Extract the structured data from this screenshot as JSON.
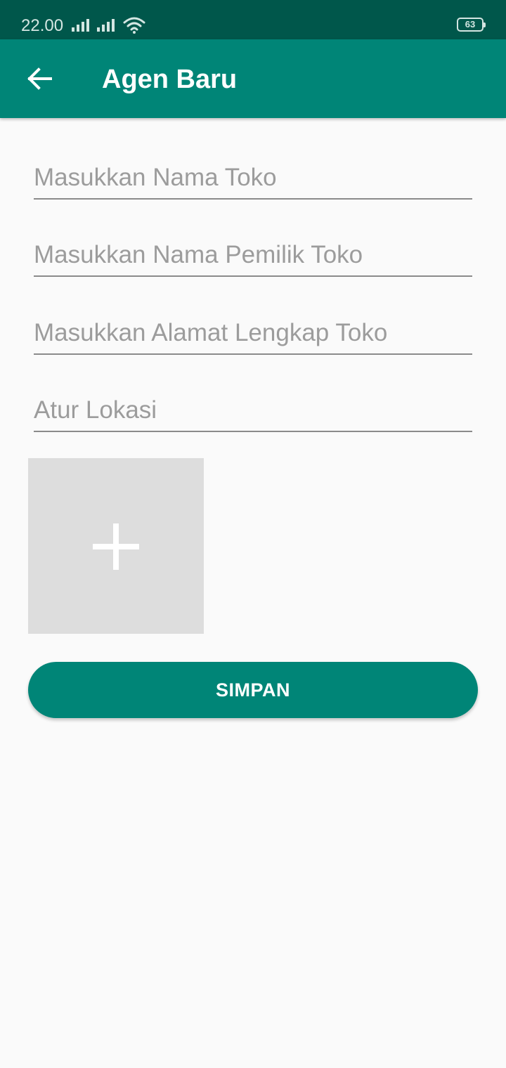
{
  "status_bar": {
    "time": "22.00",
    "battery": "63",
    "icons": [
      "signal-icon",
      "signal-icon",
      "wifi-icon",
      "battery-icon"
    ]
  },
  "app_bar": {
    "back_icon": "arrow-back-icon",
    "title": "Agen Baru",
    "background_color": "#008577"
  },
  "form": {
    "fields": [
      {
        "placeholder": "Masukkan Nama Toko",
        "value": ""
      },
      {
        "placeholder": "Masukkan Nama Pemilik Toko",
        "value": ""
      },
      {
        "placeholder": "Masukkan Alamat Lengkap Toko",
        "value": ""
      },
      {
        "placeholder": "Atur Lokasi",
        "value": ""
      }
    ],
    "image_picker_icon": "plus-icon",
    "save_label": "SIMPAN"
  },
  "colors": {
    "primary": "#008577",
    "primary_dark": "#00574b",
    "background": "#fafafa",
    "image_placeholder": "#dddddd"
  }
}
